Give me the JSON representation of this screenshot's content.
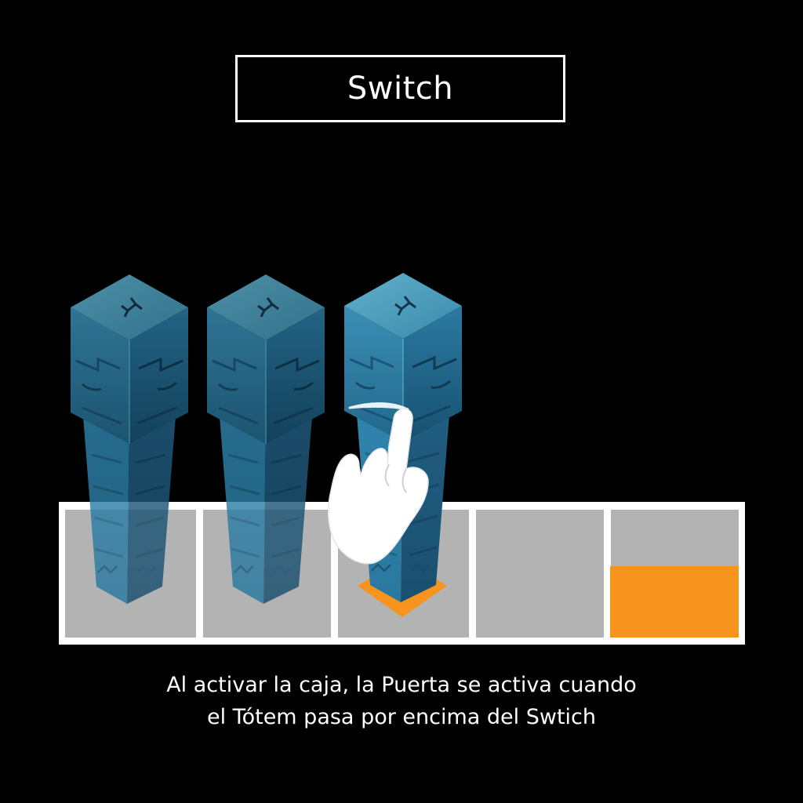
{
  "title": "Switch",
  "caption": {
    "line1": "Al activar la caja, la Puerta se activa cuando",
    "line2": "el Tótem pasa por encima del Swtich"
  },
  "colors": {
    "background": "#000000",
    "board_frame": "#ffffff",
    "tile": "#b3b3b3",
    "accent_orange": "#f7941d",
    "totem_top": "#4a9ab8",
    "totem_side_light": "#2d7ba0",
    "totem_side_dark": "#1d5a7c"
  },
  "icons": {
    "hand": "pointing-hand-tap-icon",
    "switch": "diamond-switch-icon",
    "door": "orange-door-block"
  }
}
